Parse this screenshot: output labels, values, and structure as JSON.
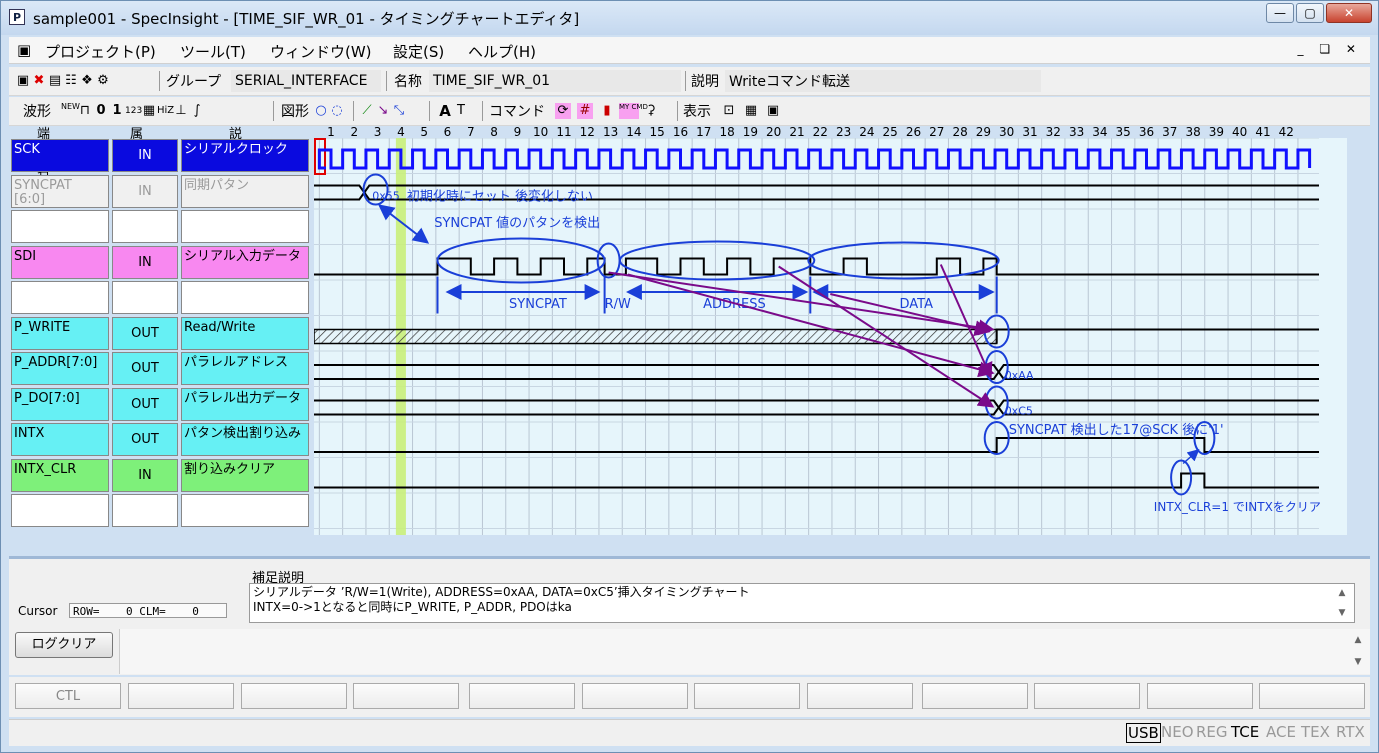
{
  "window": {
    "title": "sample001 - SpecInsight - [TIME_SIF_WR_01 - タイミングチャートエディタ]"
  },
  "menu": {
    "items": [
      "プロジェクト(P)",
      "ツール(T)",
      "ウィンドウ(W)",
      "設定(S)",
      "ヘルプ(H)"
    ]
  },
  "info_bar": {
    "group_label": "グループ",
    "group_value": "SERIAL_INTERFACE",
    "name_label": "名称",
    "name_value": "TIME_SIF_WR_01",
    "desc_label": "説明",
    "desc_value": "Writeコマンド転送"
  },
  "toolbar2": {
    "waveform_label": "波形",
    "shape_label": "図形",
    "command_label": "コマンド",
    "display_label": "表示",
    "zero": "0",
    "one": "1",
    "hiz": "HiZ",
    "new": "NEW",
    "n123": "123",
    "mycmd": "MY CMD",
    "text_a": "A",
    "text_t": "T"
  },
  "columns": {
    "terminal": "端子名",
    "attribute": "属性",
    "description": "説明"
  },
  "ticks": [
    "1",
    "2",
    "3",
    "4",
    "5",
    "6",
    "7",
    "8",
    "9",
    "10",
    "11",
    "12",
    "13",
    "14",
    "15",
    "16",
    "17",
    "18",
    "19",
    "20",
    "21",
    "22",
    "23",
    "24",
    "25",
    "26",
    "27",
    "28",
    "29",
    "30",
    "31",
    "32",
    "33",
    "34",
    "35",
    "36",
    "37",
    "38",
    "39",
    "40",
    "41",
    "42"
  ],
  "signals": [
    {
      "name": "SCK",
      "attr": "IN",
      "desc": "シリアルクロック",
      "color": "#0a0adf",
      "text_color": "#ffffff"
    },
    {
      "name": "SYNCPAT\n[6:0]",
      "attr": "IN",
      "desc": "同期パタン",
      "color": "#f0f0f0",
      "text_color": "#9a9a9a"
    },
    {
      "name": "",
      "attr": "",
      "desc": "",
      "color": "#ffffff",
      "text_color": "#000000"
    },
    {
      "name": "SDI",
      "attr": "IN",
      "desc": "シリアル入力データ",
      "color": "#f888f0",
      "text_color": "#000000"
    },
    {
      "name": "",
      "attr": "",
      "desc": "",
      "color": "#ffffff",
      "text_color": "#000000"
    },
    {
      "name": "P_WRITE",
      "attr": "OUT",
      "desc": "Read/Write",
      "color": "#66f0f4",
      "text_color": "#000000"
    },
    {
      "name": "P_ADDR[7:0]",
      "attr": "OUT",
      "desc": "パラレルアドレス",
      "color": "#66f0f4",
      "text_color": "#000000"
    },
    {
      "name": "P_DO[7:0]",
      "attr": "OUT",
      "desc": "パラレル出力データ",
      "color": "#66f0f4",
      "text_color": "#000000"
    },
    {
      "name": "INTX",
      "attr": "OUT",
      "desc": "パタン検出割り込み",
      "color": "#66f0f4",
      "text_color": "#000000"
    },
    {
      "name": "INTX_CLR",
      "attr": "IN",
      "desc": "割り込みクリア",
      "color": "#7ef07a",
      "text_color": "#000000"
    },
    {
      "name": "",
      "attr": "",
      "desc": "",
      "color": "#ffffff",
      "text_color": "#000000"
    }
  ],
  "annotations": {
    "syncpat_value": "0x55",
    "init_note": "初期化時にセット 後変化しない",
    "detect_note": "SYNCPAT 値のパタンを検出",
    "seg_syncpat": "SYNCPAT",
    "seg_rw": "R/W",
    "seg_address": "ADDRESS",
    "seg_data": "DATA",
    "addr_value": "0xAA",
    "data_value": "0xC5",
    "intx_note": "SYNCPAT 検出した17@SCK 後に'1'",
    "clr_note": "INTX_CLR=1 でINTXをクリア"
  },
  "notes": {
    "label": "補足説明",
    "line1": "シリアルデータ ’R/W=1(Write), ADDRESS=0xAA, DATA=0xC5’挿入タイミングチャート",
    "line2": "INTX=0->1となると同時にP_WRITE, P_ADDR, PDOはka"
  },
  "cursor": {
    "label": "Cursor",
    "value": "ROW=    0 CLM=    0"
  },
  "log": {
    "clear_button": "ログクリア"
  },
  "fkeys": [
    "CTL",
    "",
    "",
    "",
    "",
    "",
    "",
    "",
    "",
    "",
    "",
    "",
    ""
  ],
  "status": [
    {
      "label": "USB",
      "state": "boxed"
    },
    {
      "label": "NEO",
      "state": "off"
    },
    {
      "label": "REG",
      "state": "off"
    },
    {
      "label": "TCE",
      "state": "on"
    },
    {
      "label": "ACE",
      "state": "off"
    },
    {
      "label": "TEX",
      "state": "off"
    },
    {
      "label": "RTX",
      "state": "off"
    }
  ],
  "colors": {
    "annotation": "#1a3fd8",
    "arrow": "#7a0a8a",
    "marker": "#c9f07a"
  }
}
